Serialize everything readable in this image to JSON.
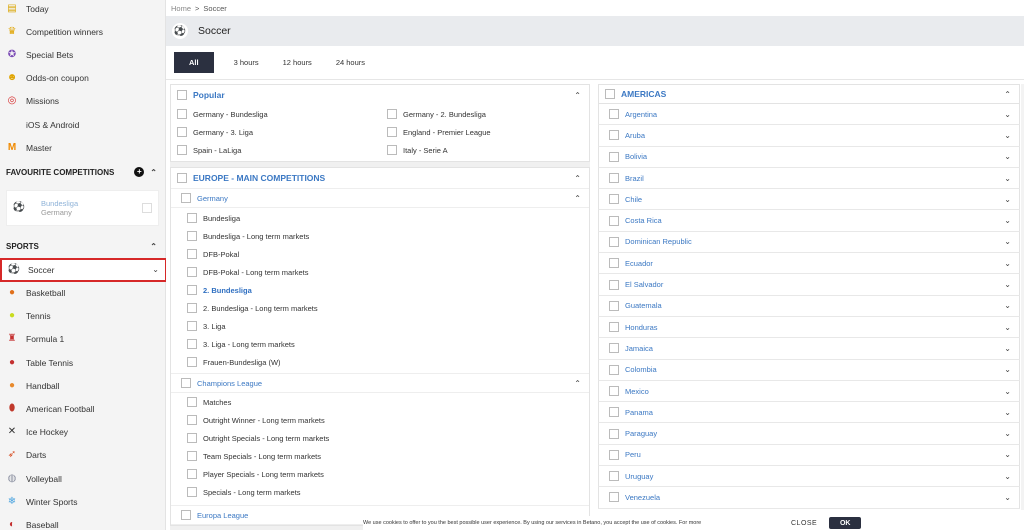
{
  "sidebar": {
    "top_items": [
      {
        "label": "Today",
        "icon": "calendar-icon"
      },
      {
        "label": "Competition winners",
        "icon": "trophy-icon"
      },
      {
        "label": "Special Bets",
        "icon": "medal-icon"
      },
      {
        "label": "Odds-on coupon",
        "icon": "coupon-icon"
      },
      {
        "label": "Missions",
        "icon": "target-icon"
      },
      {
        "label": "iOS & Android",
        "icon": "mobile-icon"
      },
      {
        "label": "Master",
        "icon": "master-icon"
      }
    ],
    "favourites_title": "FAVOURITE COMPETITIONS",
    "favourite": {
      "name": "Bundesliga",
      "country": "Germany"
    },
    "sports_title": "SPORTS",
    "sports": [
      {
        "label": "Soccer",
        "icon": "soccer-ball-icon"
      },
      {
        "label": "Basketball",
        "icon": "basketball-icon"
      },
      {
        "label": "Tennis",
        "icon": "tennis-ball-icon"
      },
      {
        "label": "Formula 1",
        "icon": "formula1-icon"
      },
      {
        "label": "Table Tennis",
        "icon": "table-tennis-icon"
      },
      {
        "label": "Handball",
        "icon": "handball-icon"
      },
      {
        "label": "American Football",
        "icon": "american-football-icon"
      },
      {
        "label": "Ice Hockey",
        "icon": "ice-hockey-icon"
      },
      {
        "label": "Darts",
        "icon": "darts-icon"
      },
      {
        "label": "Volleyball",
        "icon": "volleyball-icon"
      },
      {
        "label": "Winter Sports",
        "icon": "snowflake-icon"
      },
      {
        "label": "Baseball",
        "icon": "baseball-icon"
      }
    ]
  },
  "breadcrumb": {
    "home": "Home",
    "sep": ">",
    "current": "Soccer"
  },
  "page_title": "Soccer",
  "tabs": [
    "All",
    "3 hours",
    "12 hours",
    "24 hours"
  ],
  "popular": {
    "title": "Popular",
    "items": [
      "Germany - Bundesliga",
      "Germany - 2. Bundesliga",
      "Germany - 3. Liga",
      "England - Premier League",
      "Spain - LaLiga",
      "Italy - Serie A"
    ]
  },
  "europe": {
    "title": "EUROPE - MAIN COMPETITIONS",
    "germany": {
      "title": "Germany",
      "items": [
        "Bundesliga",
        "Bundesliga - Long term markets",
        "DFB-Pokal",
        "DFB-Pokal - Long term markets",
        "2. Bundesliga",
        "2. Bundesliga - Long term markets",
        "3. Liga",
        "3. Liga - Long term markets",
        "Frauen-Bundesliga (W)"
      ]
    },
    "champions": {
      "title": "Champions League",
      "items": [
        "Matches",
        "Outright Winner - Long term markets",
        "Outright Specials - Long term markets",
        "Team Specials - Long term markets",
        "Player Specials - Long term markets",
        "Specials - Long term markets"
      ]
    },
    "europa": {
      "title": "Europa League"
    }
  },
  "americas": {
    "title": "AMERICAS",
    "items": [
      "Argentina",
      "Aruba",
      "Bolivia",
      "Brazil",
      "Chile",
      "Costa Rica",
      "Dominican Republic",
      "Ecuador",
      "El Salvador",
      "Guatemala",
      "Honduras",
      "Jamaica",
      "Colombia",
      "Mexico",
      "Panama",
      "Paraguay",
      "Peru",
      "Uruguay",
      "Venezuela"
    ]
  },
  "cookie": {
    "message": "We use cookies to offer to you the best possible user experience. By using our services in Betano, you accept the use of cookies. For more",
    "close": "CLOSE",
    "ok": "OK"
  }
}
